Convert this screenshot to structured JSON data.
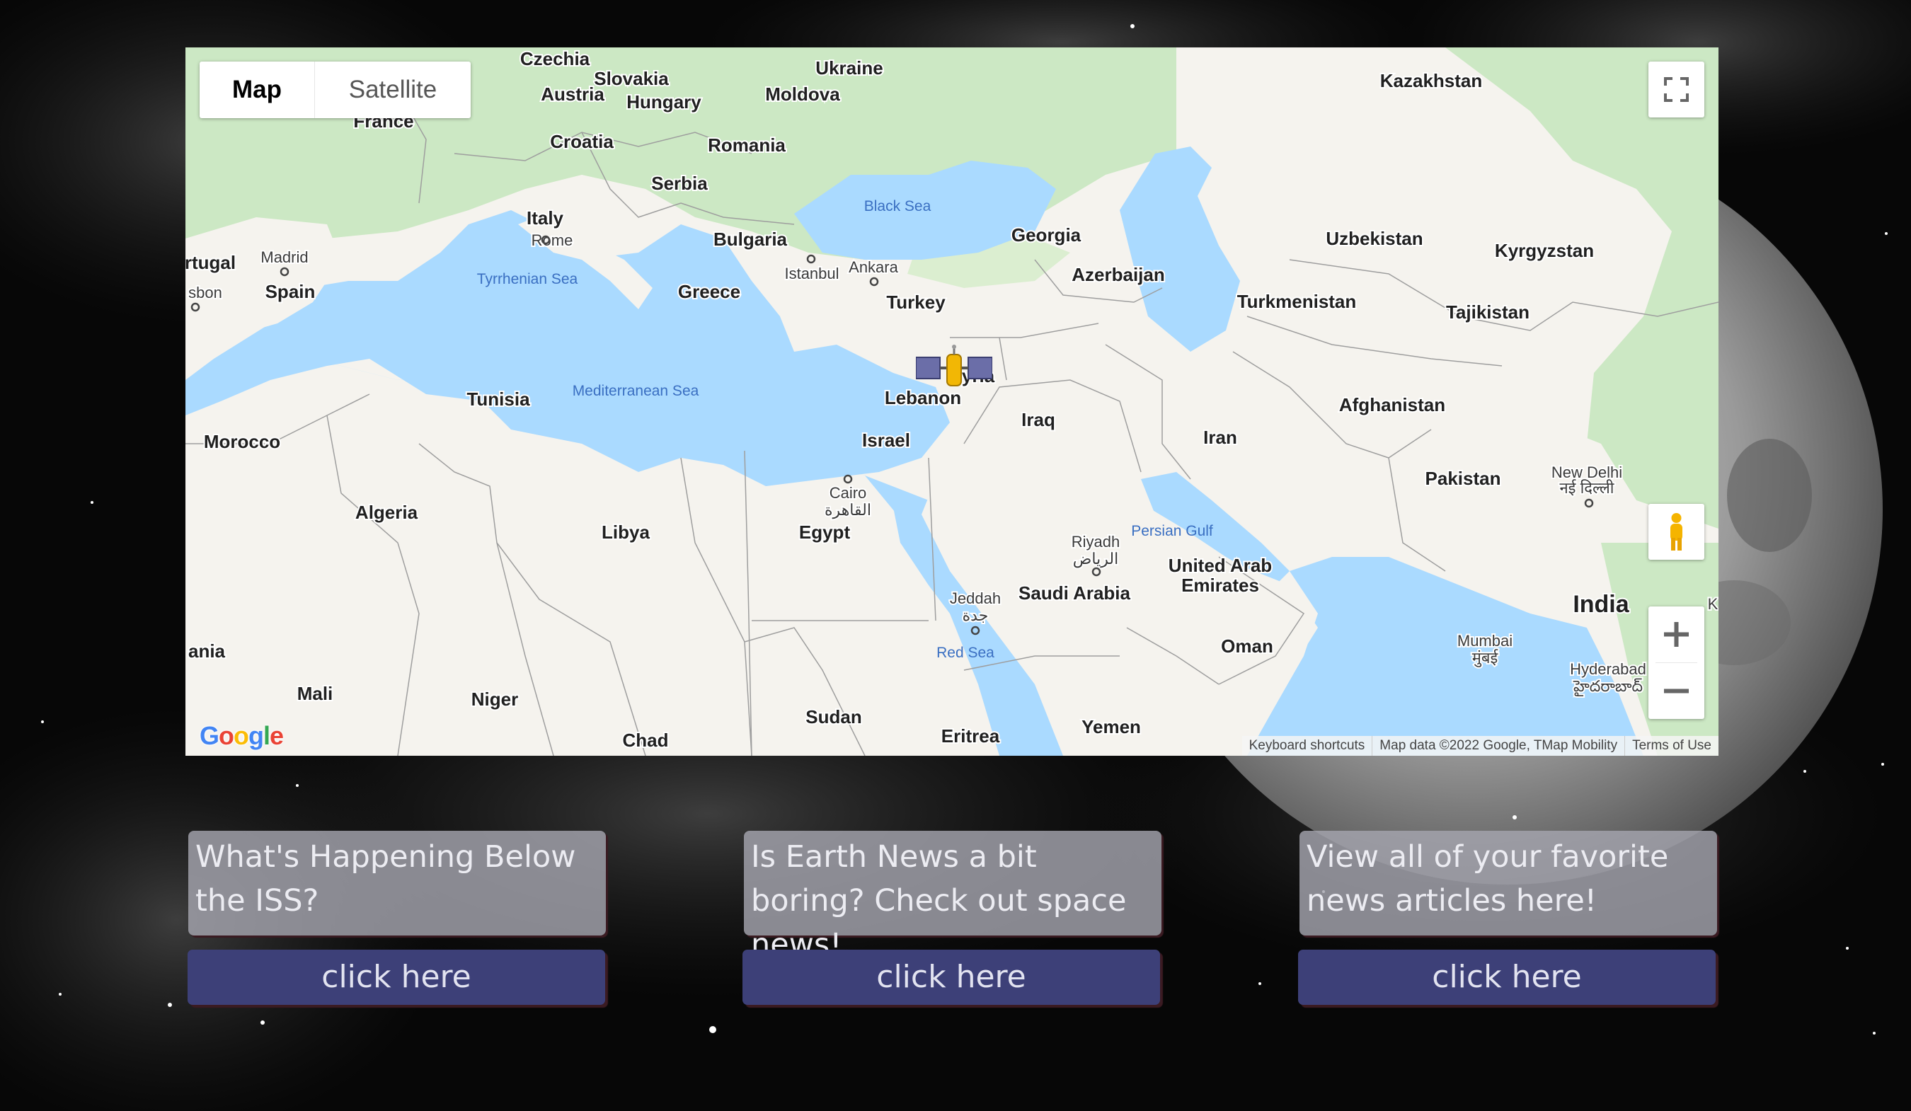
{
  "map": {
    "type_control": {
      "map_label": "Map",
      "satellite_label": "Satellite",
      "selected": "Map"
    },
    "labels": {
      "countries": [
        "Czechia",
        "Slovakia",
        "Ukraine",
        "Kazakhstan",
        "Austria",
        "Hungary",
        "Moldova",
        "France",
        "Croatia",
        "Romania",
        "Serbia",
        "Italy",
        "Bulgaria",
        "Georgia",
        "Uzbekistan",
        "Kyrgyzstan",
        "rtugal",
        "Spain",
        "Greece",
        "Azerbaijan",
        "Turkey",
        "Turkmenistan",
        "Tajikistan",
        "Tunisia",
        "Lebanon",
        "yria",
        "Afghanistan",
        "Iraq",
        "Morocco",
        "Israel",
        "Iran",
        "Pakistan",
        "Algeria",
        "Libya",
        "Egypt",
        "Saudi Arabia",
        "United Arab",
        "Emirates",
        "India",
        "ania",
        "Oman",
        "Mali",
        "Niger",
        "Sudan",
        "Chad",
        "Eritrea",
        "Yemen"
      ],
      "cities": [
        "Rome",
        "Madrid",
        "sbon",
        "Istanbul",
        "Ankara",
        "Cairo",
        "القاهرة",
        "Riyadh",
        "الرياض",
        "New Delhi",
        "नई दिल्ली",
        "Jeddah",
        "جدة",
        "Mumbai",
        "मुंबई",
        "Hyderabad",
        "హైదరాబాద్",
        "K"
      ],
      "seas": [
        "Black Sea",
        "Tyrrhenian Sea",
        "Mediterranean Sea",
        "Persian Gulf",
        "Red Sea"
      ]
    },
    "marker_icon": "satellite-icon",
    "google_logo": "Google",
    "attribution": {
      "keyboard": "Keyboard shortcuts",
      "data": "Map data ©2022 Google, TMap Mobility",
      "terms": "Terms of Use"
    }
  },
  "cards": [
    {
      "text": "What's Happening Below the ISS?",
      "button": "click here"
    },
    {
      "text": "Is Earth News a bit boring? Check out space news!",
      "button": "click here"
    },
    {
      "text": "View all of your favorite news articles here!",
      "button": "click here"
    }
  ],
  "colors": {
    "card_bg": "#a5a5af",
    "button_bg": "#3d4078",
    "card_shadow": "#3b1b22",
    "water": "#aadaff",
    "land": "#f5f3ee",
    "vegetation": "#cce8c4"
  }
}
